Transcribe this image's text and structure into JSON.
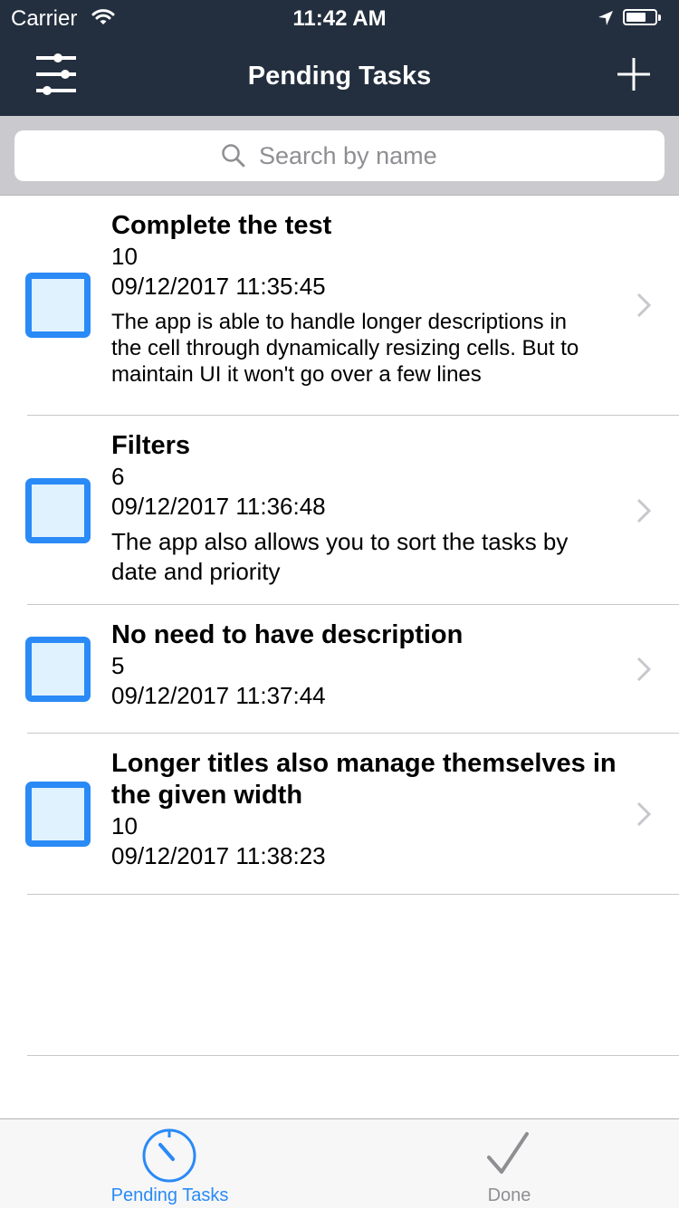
{
  "status_bar": {
    "carrier": "Carrier",
    "time": "11:42 AM",
    "battery_level": 0.7
  },
  "nav": {
    "title": "Pending Tasks",
    "left_icon": "filter-sliders-icon",
    "right_icon": "plus-icon"
  },
  "search": {
    "placeholder": "Search by name",
    "value": ""
  },
  "tasks": [
    {
      "title": "Complete the test",
      "priority": "10",
      "date": "09/12/2017 11:35:45",
      "description": "The app is able to handle longer descriptions in the cell through dynamically resizing cells. But to maintain UI it won't go over a few lines"
    },
    {
      "title": "Filters",
      "priority": "6",
      "date": "09/12/2017 11:36:48",
      "description": "The app also allows you to sort the tasks by date and priority"
    },
    {
      "title": "No need to have description",
      "priority": "5",
      "date": "09/12/2017 11:37:44",
      "description": ""
    },
    {
      "title": "Longer titles also manage themselves in the given width",
      "priority": "10",
      "date": "09/12/2017 11:38:23",
      "description": ""
    }
  ],
  "tabs": [
    {
      "label": "Pending Tasks",
      "icon": "timer-icon",
      "selected": true
    },
    {
      "label": "Done",
      "icon": "checkmark-icon",
      "selected": false
    }
  ],
  "colors": {
    "nav_background": "#232f3e",
    "accent": "#2a8af6",
    "checkbox_fill": "#dff2fd",
    "tab_inactive": "#8e8e93"
  }
}
